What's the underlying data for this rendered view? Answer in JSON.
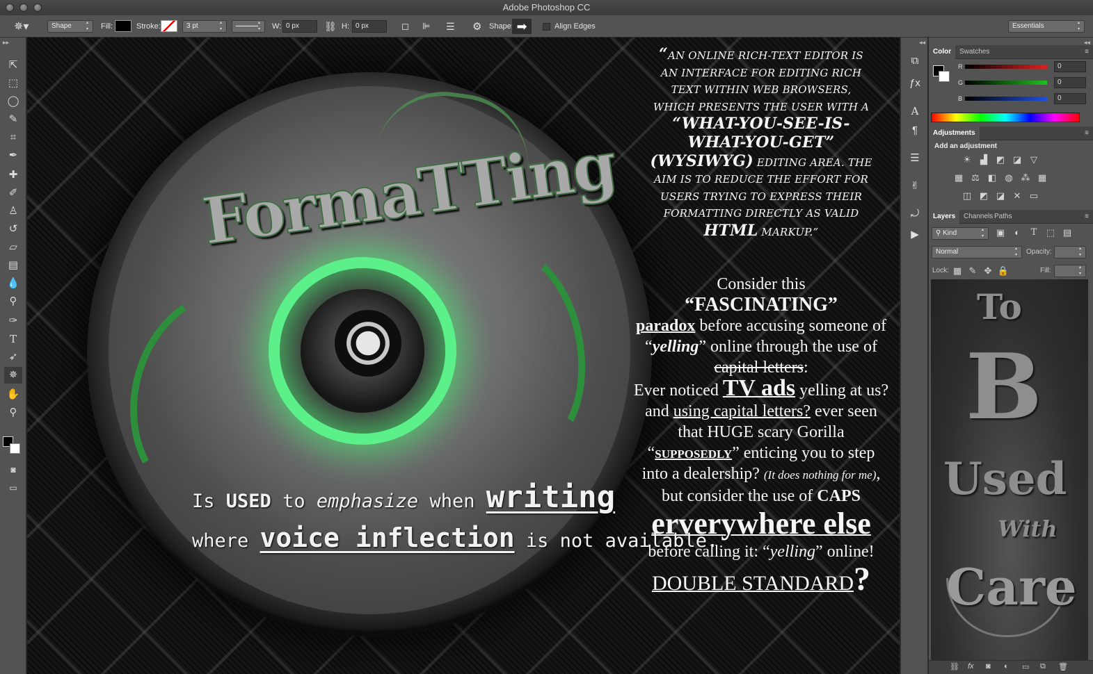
{
  "window": {
    "title": "Adobe Photoshop CC"
  },
  "options_bar": {
    "tool_mode": "Shape",
    "fill_label": "Fill:",
    "stroke_label": "Stroke:",
    "stroke_width": "3 pt",
    "w_label": "W:",
    "w_value": "0 px",
    "h_label": "H:",
    "h_value": "0 px",
    "shape_label": "Shape:",
    "align_edges_label": "Align Edges",
    "workspace": "Essentials"
  },
  "canvas": {
    "logo_text": "FormaTTing",
    "emphasis": {
      "w1": "Is",
      "w2": "USED",
      "w3": "to",
      "w4": "emphasize",
      "w5": "when",
      "w6": "writing",
      "w7": "where",
      "w8": "voice inflection",
      "w9": "is not available."
    },
    "quote_text": "An online rich-text editor is an interface for editing rich text within web browsers, which presents the user with a",
    "quote_wysiwyg": "“what-you-see-is-what-you-get” (WYSIWYG)",
    "quote_tail": "editing area. The aim is to reduce the effort for users trying to express their formatting directly as valid",
    "quote_html": "HTML",
    "quote_end": "markup.”",
    "quote_open": "“",
    "para": {
      "p1": "Consider this",
      "p2": "“FASCINATING”",
      "p3a": "paradox",
      "p3b": " before accusing someone of “",
      "p3c": "yelling",
      "p3d": "” online through the use of ",
      "p3e": "capital letters",
      "p3f": ":",
      "p4a": "Ever noticed ",
      "p4b": "TV ads",
      "p4c": " yelling at us? and ",
      "p4d": "using capital letters?",
      "p4e": " ever seen that HUGE scary Gorilla “",
      "p4f": "supposedly",
      "p4g": "” enticing you to step into a dealership? ",
      "p4h": "(It does nothing for me)",
      "p4i": ", but consider the use of ",
      "p4j": "CAPS",
      "p5": "erverywhere else",
      "p6a": "before calling it: “",
      "p6b": "yelling",
      "p6c": "” online!",
      "p7": "DOUBLE STANDARD",
      "p7q": "?"
    }
  },
  "panels": {
    "color_tabs": [
      "Color",
      "Swatches"
    ],
    "channels": [
      {
        "label": "R",
        "value": "0",
        "color": "#e02020"
      },
      {
        "label": "G",
        "value": "0",
        "color": "#20c020"
      },
      {
        "label": "B",
        "value": "0",
        "color": "#2050e0"
      }
    ],
    "adjustments_tab": "Adjustments",
    "add_adjustment": "Add an adjustment",
    "layer_tabs": [
      "Layers",
      "Channels",
      "Paths"
    ],
    "kind_filter": "Kind",
    "blend_mode": "Normal",
    "opacity_label": "Opacity:",
    "lock_label": "Lock:",
    "fill_label": "Fill:",
    "thumb_text": {
      "to": "To",
      "b": "B",
      "used": "Used",
      "with": "With",
      "care": "Care"
    }
  },
  "icons": {
    "tools": [
      "move-icon",
      "marquee-icon",
      "lasso-icon",
      "quick-select-icon",
      "crop-icon",
      "eyedropper-icon",
      "healing-icon",
      "brush-icon",
      "stamp-icon",
      "history-brush-icon",
      "eraser-icon",
      "gradient-icon",
      "blur-icon",
      "dodge-icon",
      "pen-icon",
      "type-icon",
      "path-select-icon",
      "custom-shape-icon",
      "hand-icon",
      "zoom-icon"
    ]
  },
  "colors": {
    "accent_green": "#5cf08a",
    "panel_bg": "#535353",
    "chrome_dark": "#282828"
  }
}
